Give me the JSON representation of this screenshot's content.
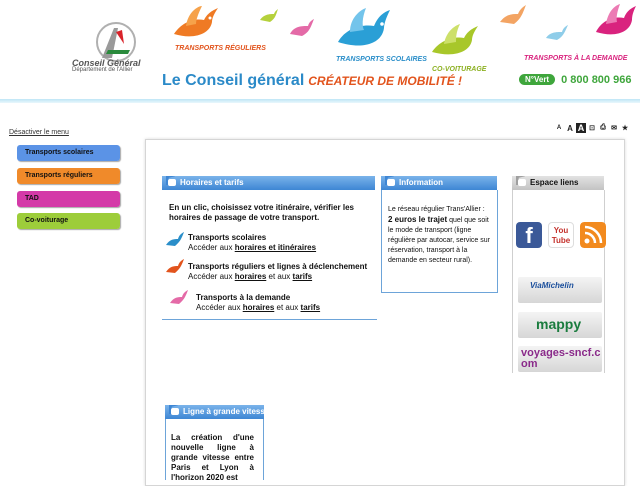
{
  "header": {
    "logo": {
      "line1": "Conseil Général",
      "line2": "Département de l'Allier"
    },
    "services": [
      {
        "label": "TRANSPORTS RÉGULIERS",
        "color": "#e2541d"
      },
      {
        "label": "TRANSPORTS SCOLAIRES",
        "color": "#2a8ec9"
      },
      {
        "label": "CO-VOITURAGE",
        "color": "#8cb021"
      },
      {
        "label": "TRANSPORTS À LA DEMANDE",
        "color": "#d9237e"
      }
    ],
    "tagline": "Le Conseil général",
    "tagline_accent": "CRÉATEUR DE MOBILITÉ !",
    "numero_vert_label": "N°Vert",
    "numero_vert": "0 800 800 966"
  },
  "nav": {
    "toggle": "Désactiver le menu",
    "items": [
      {
        "label": "Transports scolaires",
        "color": "#5b93e6"
      },
      {
        "label": "Transports réguliers",
        "color": "#f08a2a"
      },
      {
        "label": "TAD",
        "color": "#d43aa8"
      },
      {
        "label": "Co-voiturage",
        "color": "#9dcd3a"
      }
    ]
  },
  "tools": [
    "A",
    "A",
    "A",
    "⊡",
    "⎙",
    "✉",
    "★"
  ],
  "horaires": {
    "title": "Horaires et tarifs",
    "intro": "En un clic, choisissez votre itinéraire, vérifier les horaires de  passage de votre transport.",
    "items": [
      {
        "title": "Transports scolaires",
        "prefix": "Accéder aux ",
        "link1": "horaires et itinéraires",
        "mid": "",
        "link2": "",
        "bird_color": "#2a8ec9"
      },
      {
        "title": "Transports réguliers et lignes à déclenchement",
        "prefix": "Accéder aux ",
        "link1": "horaires",
        "mid": " et aux ",
        "link2": "tarifs",
        "bird_color": "#e2541d"
      },
      {
        "title": "Transports à la demande",
        "prefix": "Accéder aux ",
        "link1": "horaires",
        "mid": " et aux ",
        "link2": "tarifs",
        "bird_color": "#d9237e"
      }
    ]
  },
  "information": {
    "title": "Information",
    "text_before": "Le réseau régulier Trans'Allier : ",
    "highlight": "2 euros le trajet",
    "text_after": " quel que soit le mode de transport (ligne régulière par autocar, service sur réservation, transport à la demande en secteur rural)."
  },
  "espace_liens": {
    "title": "Espace liens",
    "social": [
      {
        "name": "facebook-icon",
        "label": "f",
        "color": "#3b5998"
      },
      {
        "name": "youtube-icon",
        "label": "You Tube",
        "color": "#c4302b"
      },
      {
        "name": "rss-icon",
        "label": "",
        "color": "#f28a1e"
      }
    ],
    "partners": [
      {
        "name": "viamichelin-logo",
        "label": "ViaMichelin"
      },
      {
        "name": "mappy-logo",
        "label": "mappy"
      },
      {
        "name": "voyages-sncf-logo",
        "label": "voyages-sncf.com"
      }
    ]
  },
  "lgv": {
    "title": "Ligne à grande vitesse",
    "text": "La création d'une nouvelle ligne à grande vitesse entre Paris et Lyon à l'horizon 2020 est"
  }
}
